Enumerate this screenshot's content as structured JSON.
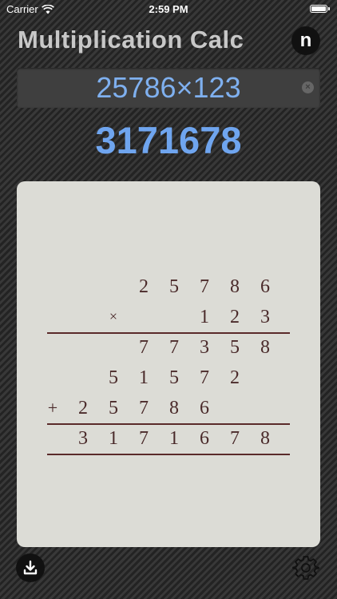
{
  "status_bar": {
    "carrier": "Carrier",
    "time": "2:59 PM"
  },
  "header": {
    "title": "Multiplication Calc",
    "menu_label": "n"
  },
  "input": {
    "expression": "25786×123"
  },
  "result": {
    "value": "3171678"
  },
  "work": {
    "multiplicand": [
      "2",
      "5",
      "7",
      "8",
      "6"
    ],
    "times_sign": "×",
    "multiplier": [
      "1",
      "2",
      "3"
    ],
    "partial_1": [
      "7",
      "7",
      "3",
      "5",
      "8"
    ],
    "partial_2": [
      "5",
      "1",
      "5",
      "7",
      "2"
    ],
    "plus_sign": "+",
    "partial_3": [
      "2",
      "5",
      "7",
      "8",
      "6"
    ],
    "total": [
      "3",
      "1",
      "7",
      "1",
      "6",
      "7",
      "8"
    ]
  },
  "icons": {
    "download": "download-icon",
    "settings": "gear-icon",
    "clear": "clear-icon"
  },
  "colors": {
    "accent": "#6fa5ef",
    "ink": "#4a2a2a",
    "card": "#dcdcd6"
  }
}
